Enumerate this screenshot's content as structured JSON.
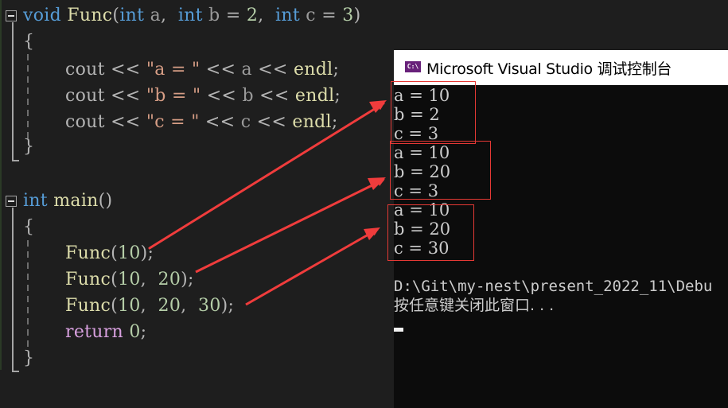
{
  "editor": {
    "func_decl": {
      "kw_void": "void",
      "name": "Func",
      "open_paren": "(",
      "kw_int_a": "int",
      "param_a": "a",
      "comma1": ",",
      "kw_int_b": "int",
      "param_b": "b",
      "eq_b": "=",
      "default_b": "2",
      "comma2": ",",
      "kw_int_c": "int",
      "param_c": "c",
      "eq_c": "=",
      "default_c": "3",
      "close_paren": ")"
    },
    "open_brace": "{",
    "close_brace": "}",
    "cout_lines": [
      {
        "cout": "cout",
        "op1": "<<",
        "str": "\"a = \"",
        "op2": "<<",
        "var": "a",
        "op3": "<<",
        "endl": "endl",
        "semi": ";"
      },
      {
        "cout": "cout",
        "op1": "<<",
        "str": "\"b = \"",
        "op2": "<<",
        "var": "b",
        "op3": "<<",
        "endl": "endl",
        "semi": ";"
      },
      {
        "cout": "cout",
        "op1": "<<",
        "str": "\"c = \"",
        "op2": "<<",
        "var": "c",
        "op3": "<<",
        "endl": "endl",
        "semi": ";"
      }
    ],
    "main_decl": {
      "kw_int": "int",
      "name": "main",
      "parens": "()"
    },
    "calls": [
      {
        "name": "Func",
        "open": "(",
        "args": [
          "10"
        ],
        "close": ")",
        "semi": ";"
      },
      {
        "name": "Func",
        "open": "(",
        "args": [
          "10",
          "20"
        ],
        "close": ")",
        "semi": ";"
      },
      {
        "name": "Func",
        "open": "(",
        "args": [
          "10",
          "20",
          "30"
        ],
        "close": ")",
        "semi": ";"
      }
    ],
    "return_stmt": {
      "kw": "return",
      "value": "0",
      "semi": ";"
    }
  },
  "console": {
    "title": "Microsoft Visual Studio 调试控制台",
    "icon_label": "C:\\",
    "output_groups": [
      [
        "a = 10",
        "b = 2",
        "c = 3"
      ],
      [
        "a = 10",
        "b = 20",
        "c = 3"
      ],
      [
        "a = 10",
        "b = 20",
        "c = 30"
      ]
    ],
    "path_line": "D:\\Git\\my-nest\\present_2022_11\\Debu",
    "prompt_line": "按任意键关闭此窗口. . ."
  },
  "annotations": {
    "highlight_color": "#e53935"
  }
}
